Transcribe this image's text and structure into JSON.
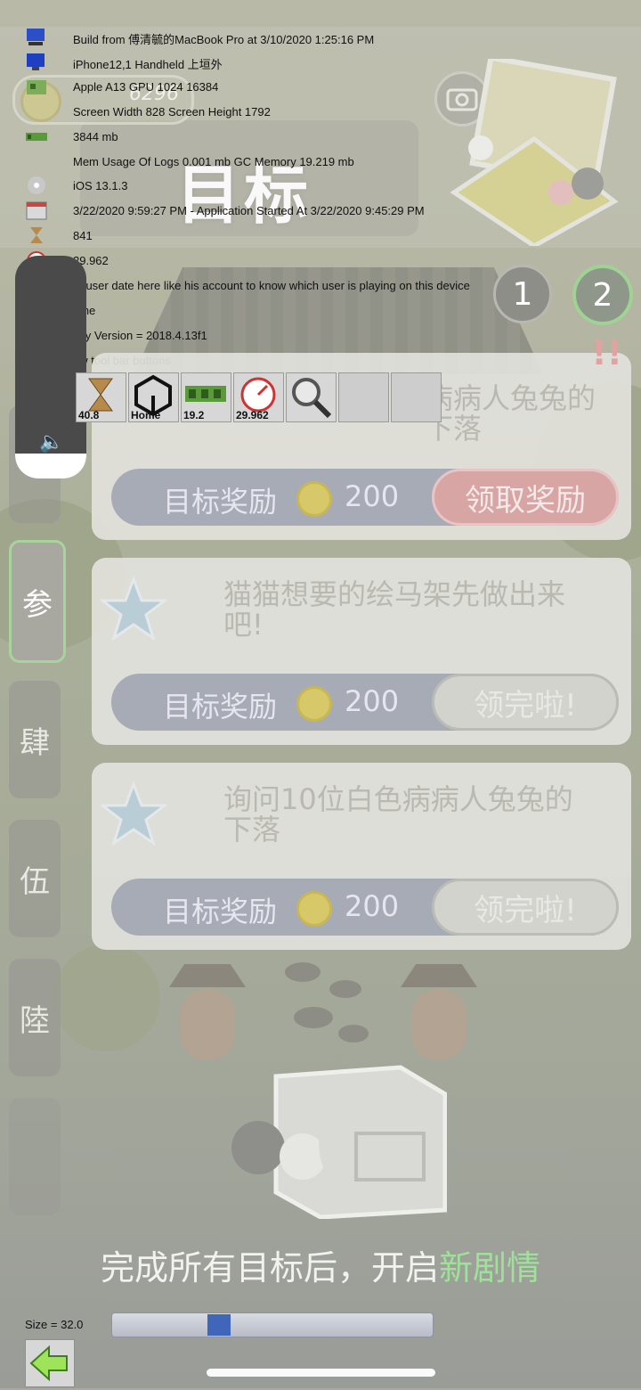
{
  "game": {
    "coin_count": "6296",
    "title": "目标",
    "page_buttons": [
      "1",
      "2"
    ],
    "active_page": "2",
    "side_tabs": [
      "参",
      "肆",
      "伍",
      "陸"
    ],
    "goals": [
      {
        "text": "病病人兔兔的下落",
        "reward_label": "目标奖励",
        "reward_amount": "200",
        "button": "领取奖励",
        "state": "ready"
      },
      {
        "text": "猫猫想要的绘马架先做出来吧!",
        "reward_label": "目标奖励",
        "reward_amount": "200",
        "button": "领完啦!",
        "state": "done"
      },
      {
        "text": "询问10位白色病病人兔兔的下落",
        "reward_label": "目标奖励",
        "reward_amount": "200",
        "button": "领完啦!",
        "state": "done"
      }
    ],
    "bottom_message_prefix": "完成所有目标后，开启",
    "bottom_message_highlight": "新剧情",
    "colors": {
      "highlight_green": "#9fe19a",
      "claim_red": "#d8a5a5",
      "active_tab_border": "#a8d39c"
    }
  },
  "debug": {
    "lines": [
      {
        "text": "Build from 傅清毓的MacBook Pro at 3/10/2020 1:25:16 PM",
        "icon": "computer-icon"
      },
      {
        "text": "iPhone12,1        Handheld        上垣外",
        "icon": "monitor-icon"
      },
      {
        "text": "Apple A13 GPU        1024        16384",
        "icon": "gpu-card-icon"
      },
      {
        "text": "Screen Width 828        Screen Height 1792",
        "icon": ""
      },
      {
        "text": "3844 mb",
        "icon": "ram-icon"
      },
      {
        "text": "Mem Usage Of Logs 0.001 mb        GC Memory 19.219 mb",
        "icon": ""
      },
      {
        "text": "iOS 13.1.3",
        "icon": "disc-icon"
      },
      {
        "text": "3/22/2020 9:59:27 PM - Application Started At 3/22/2020 9:45:29 PM",
        "icon": "calendar-icon"
      },
      {
        "text": "841",
        "icon": "hourglass-icon"
      },
      {
        "text": "29.962",
        "icon": "gauge-icon"
      },
      {
        "text": "ut user date here like his account to know which user is playing on this device",
        "icon": ""
      },
      {
        "text": "ome",
        "icon": ""
      },
      {
        "text": "nity Version = 2018.4.13f1",
        "icon": ""
      },
      {
        "text": "ow tool bar buttons",
        "icon": ""
      }
    ],
    "toolbar": [
      {
        "icon": "hourglass-icon",
        "caption": "40.8"
      },
      {
        "icon": "unity-icon",
        "caption": "Home"
      },
      {
        "icon": "ram-icon",
        "caption": "19.2"
      },
      {
        "icon": "gauge-icon",
        "caption": "29.962"
      },
      {
        "icon": "magnifier-icon",
        "caption": ""
      },
      {
        "icon": "",
        "caption": ""
      },
      {
        "icon": "",
        "caption": ""
      }
    ],
    "size_label": "Size = 32.0",
    "size_slider_value": 0.32
  }
}
